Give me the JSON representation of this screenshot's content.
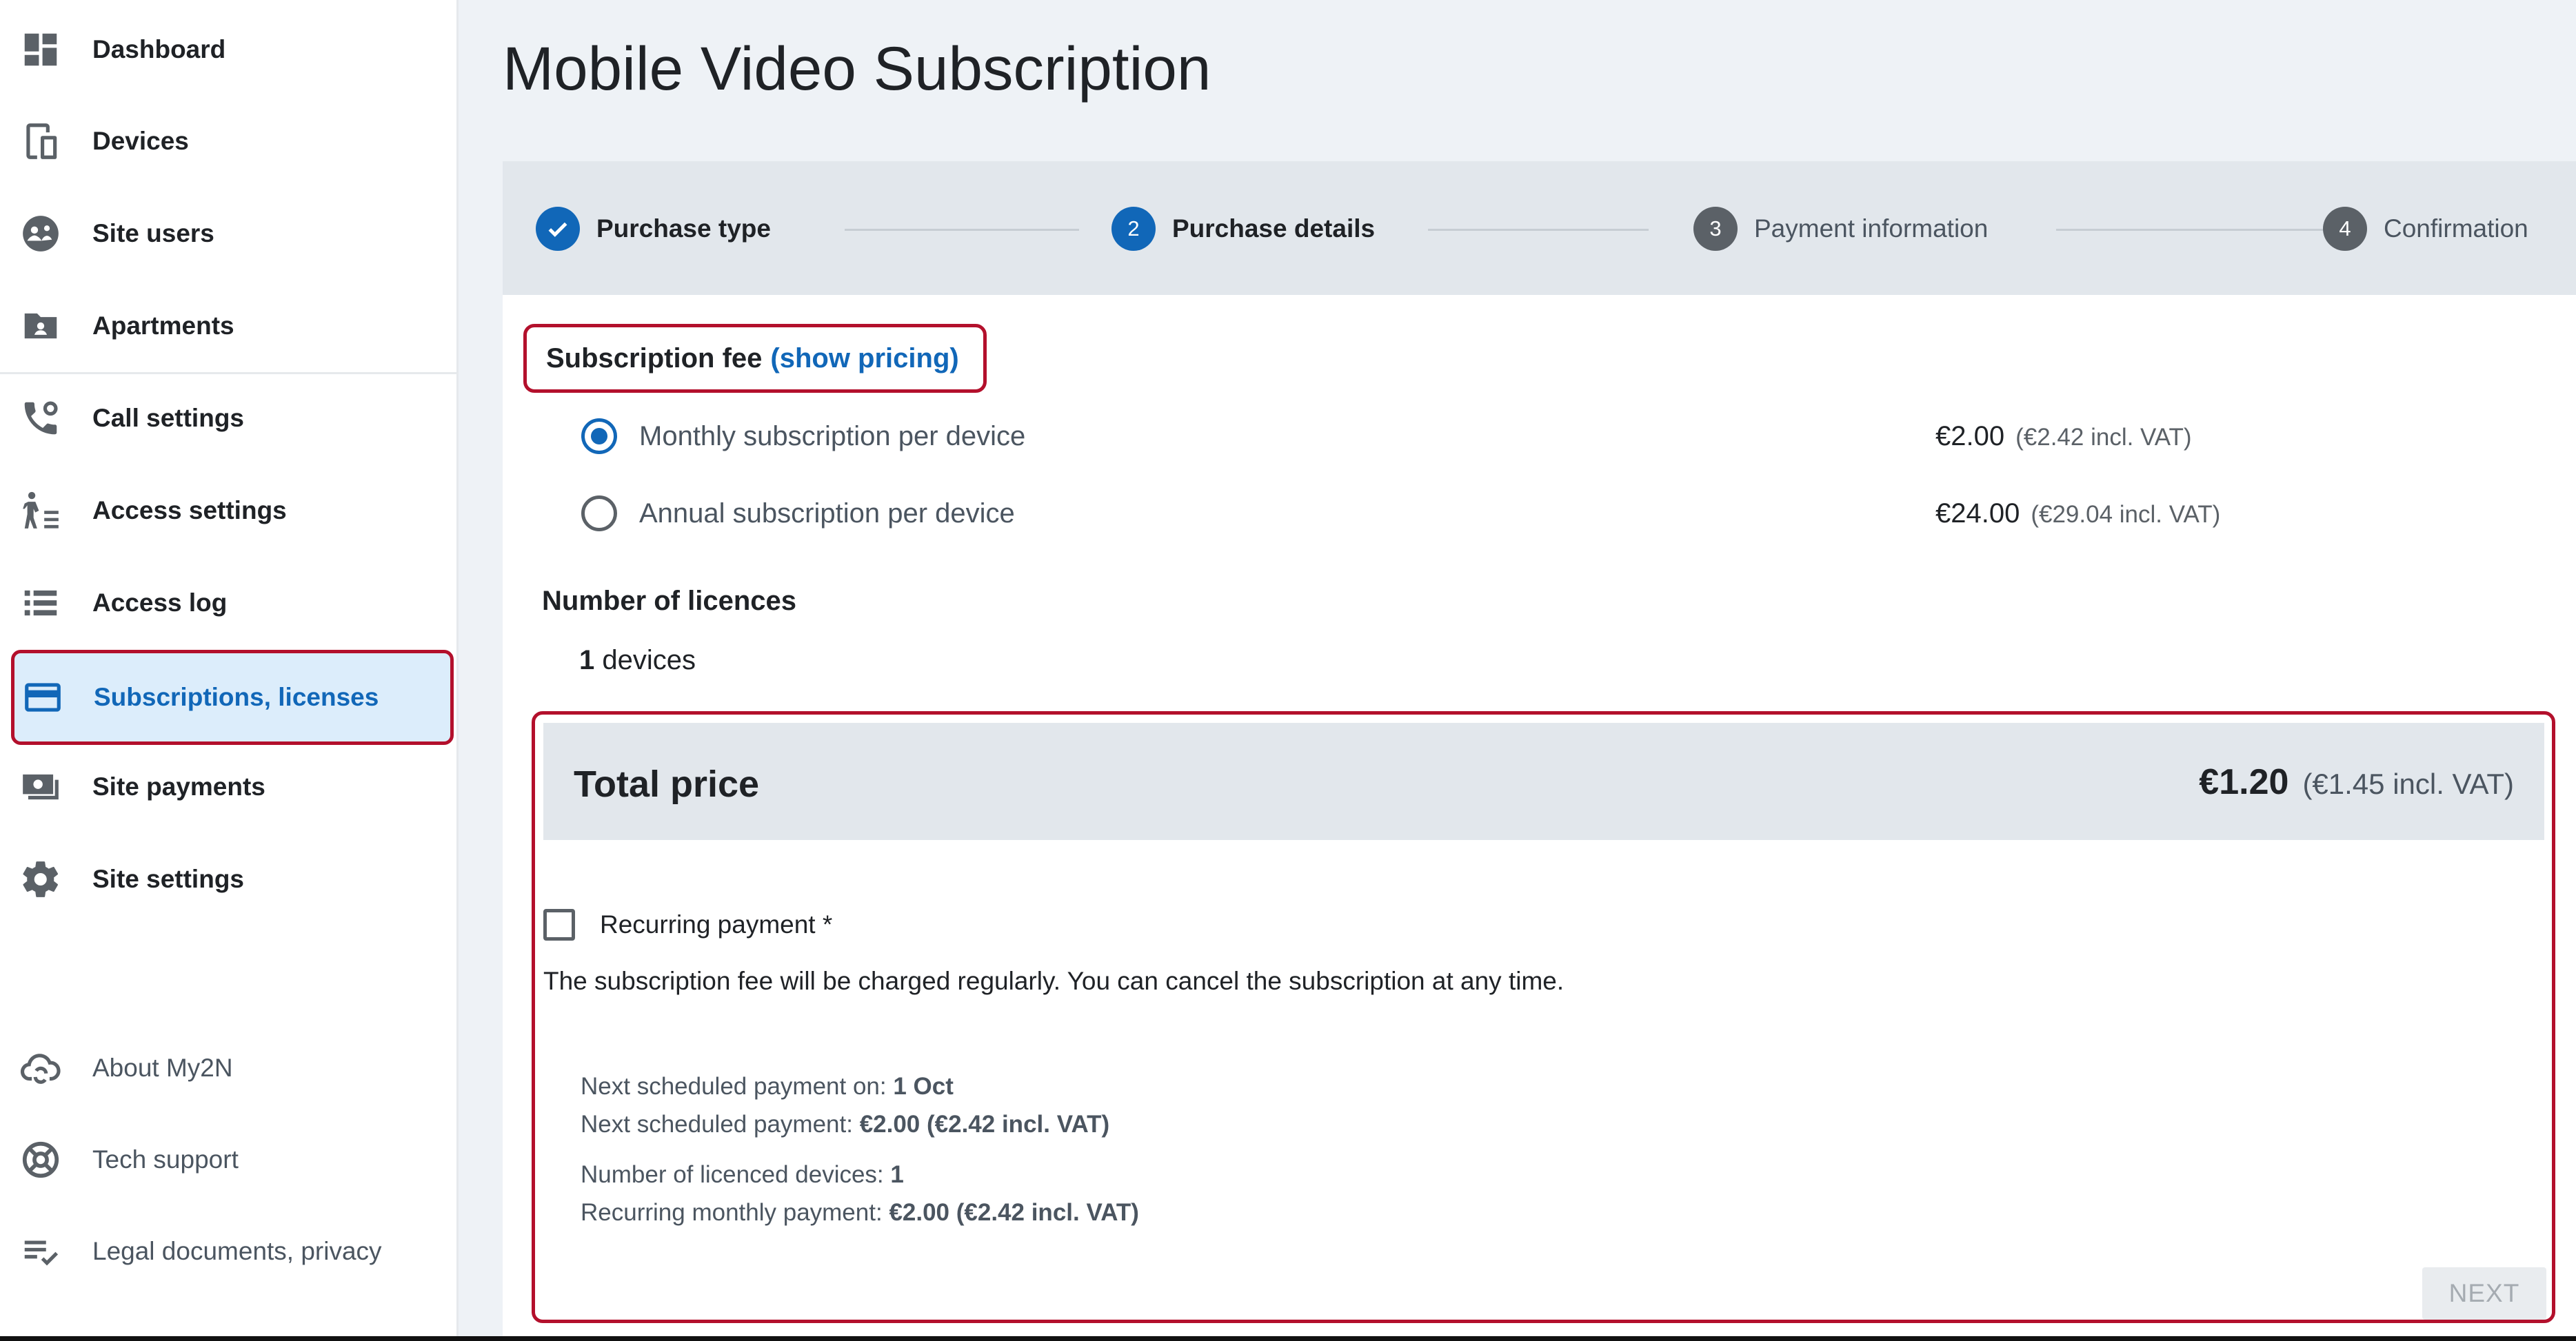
{
  "sidebar": {
    "items": [
      {
        "label": "Dashboard",
        "icon": "dashboard-icon"
      },
      {
        "label": "Devices",
        "icon": "devices-icon"
      },
      {
        "label": "Site users",
        "icon": "site-users-icon"
      },
      {
        "label": "Apartments",
        "icon": "apartments-icon"
      },
      {
        "label": "Call settings",
        "icon": "call-settings-icon"
      },
      {
        "label": "Access settings",
        "icon": "access-settings-icon"
      },
      {
        "label": "Access log",
        "icon": "access-log-icon"
      },
      {
        "label": "Subscriptions, licenses",
        "icon": "credit-card-icon",
        "active": true
      },
      {
        "label": "Site payments",
        "icon": "site-payments-icon"
      },
      {
        "label": "Site settings",
        "icon": "gear-icon"
      }
    ],
    "footer": [
      {
        "label": "About My2N",
        "icon": "cloud-sync-icon"
      },
      {
        "label": "Tech support",
        "icon": "lifebuoy-icon"
      },
      {
        "label": "Legal documents, privacy",
        "icon": "list-check-icon"
      }
    ]
  },
  "page": {
    "title": "Mobile Video Subscription"
  },
  "stepper": {
    "steps": [
      {
        "number": "1",
        "label": "Purchase type",
        "state": "done"
      },
      {
        "number": "2",
        "label": "Purchase details",
        "state": "current"
      },
      {
        "number": "3",
        "label": "Payment information",
        "state": "pending"
      },
      {
        "number": "4",
        "label": "Confirmation",
        "state": "pending"
      }
    ]
  },
  "fee": {
    "title": "Subscription fee",
    "link": "(show pricing)",
    "options": [
      {
        "label": "Monthly subscription per device",
        "price": "€2.00",
        "price_vat": "(€2.42 incl. VAT)",
        "selected": true
      },
      {
        "label": "Annual subscription per device",
        "price": "€24.00",
        "price_vat": "(€29.04 incl. VAT)",
        "selected": false
      }
    ]
  },
  "licences": {
    "title": "Number of licences",
    "count": "1",
    "unit": "devices"
  },
  "total": {
    "label": "Total price",
    "amount": "€1.20",
    "vat": "(€1.45 incl. VAT)"
  },
  "recurring": {
    "label": "Recurring payment *",
    "checked": false,
    "note": "The subscription fee will be charged regularly. You can cancel the subscription at any time."
  },
  "schedule": {
    "next_date_label": "Next scheduled payment on:",
    "next_date_value": "1 Oct",
    "next_payment_label": "Next scheduled payment:",
    "next_payment_value": "€2.00 (€2.42 incl. VAT)",
    "devices_label": "Number of licenced devices:",
    "devices_value": "1",
    "monthly_label": "Recurring monthly payment:",
    "monthly_value": "€2.00 (€2.42 incl. VAT)"
  },
  "actions": {
    "next": "NEXT"
  },
  "colors": {
    "accent": "#1167b8",
    "highlight": "#b3102c",
    "active_bg": "#dcedfb"
  }
}
